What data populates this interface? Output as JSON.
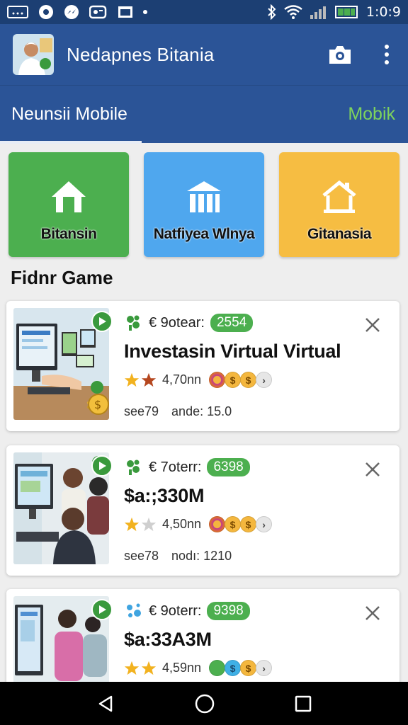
{
  "status_bar": {
    "time": "1:0:9",
    "icons": [
      "notification-icon",
      "record-icon",
      "messenger-icon",
      "game-icon",
      "image-icon",
      "dot-icon",
      "bluetooth-icon",
      "wifi-icon",
      "signal-icon",
      "battery-icon"
    ]
  },
  "app_bar": {
    "title": "Nedapnes Bitania",
    "actions": [
      "camera-icon",
      "more-vert-icon"
    ]
  },
  "tabs": {
    "active_label": "Neunsii Mobile",
    "other_label": "Mobik"
  },
  "tiles": [
    {
      "label": "Bitansin",
      "icon": "home-icon",
      "color": "#4caf4f"
    },
    {
      "label": "Natfiyea Wlnya",
      "icon": "building-icon",
      "color": "#4fa7ee"
    },
    {
      "label": "Gitanasia",
      "icon": "house-icon",
      "color": "#f6bd42"
    }
  ],
  "section_title": "Fidnr Game",
  "cards": [
    {
      "meta_label": "€ 9otear:",
      "pill": "2554",
      "title": "Investasin Virtual Virtual",
      "stars": 2,
      "rating": "4,70nn",
      "stat_a": "see79",
      "stat_b": "ande:  15.0",
      "coins": [
        "coin-ring",
        "coin-gold",
        "coin-gold",
        "coin-grey"
      ]
    },
    {
      "meta_label": "€ 7oterr:",
      "pill": "6398",
      "title": "$a:;330M",
      "stars": 1,
      "rating": "4,50nn",
      "stat_a": "see78",
      "stat_b": "nodı:  1210",
      "coins": [
        "coin-ring",
        "coin-gold",
        "coin-gold",
        "coin-grey"
      ]
    },
    {
      "meta_label": "€ 9oterr:",
      "pill": "9398",
      "title": "$a:33А3M",
      "stars": 2,
      "rating": "4,59nn",
      "stat_a": "",
      "stat_b": "",
      "coins": [
        "coin-green",
        "coin-blue",
        "coin-gold",
        "coin-grey"
      ]
    }
  ],
  "nav_bar": {
    "buttons": [
      "back-icon",
      "home-circle-icon",
      "recents-icon"
    ]
  }
}
